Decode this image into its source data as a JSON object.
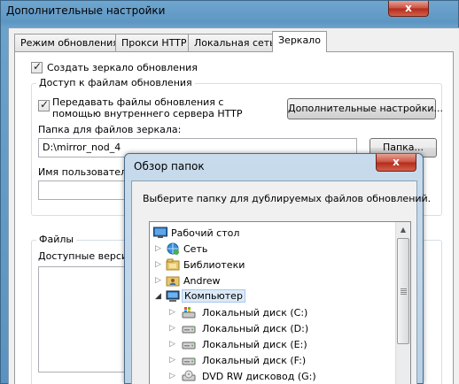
{
  "main_window": {
    "title": "Дополнительные настройки",
    "close_glyph": "x",
    "tabs": [
      {
        "label": "Режим обновления",
        "active": false
      },
      {
        "label": "Прокси HTTP",
        "active": false
      },
      {
        "label": "Локальная сеть",
        "active": false
      },
      {
        "label": "Зеркало",
        "active": true
      }
    ],
    "create_mirror": {
      "label": "Создать зеркало обновления",
      "checked": true
    },
    "access_group": {
      "title": "Доступ к файлам обновления",
      "http_server": {
        "label": "Передавать файлы обновления с помощью внутреннего сервера HTTP",
        "checked": true
      },
      "advanced_button": "Дополнительные настройки...",
      "folder_label": "Папка для файлов зеркала:",
      "folder_value": "D:\\mirror_nod_4",
      "folder_button": "Папка...",
      "username_label": "Имя пользователя:"
    },
    "files_group": {
      "title": "Файлы",
      "available_label": "Доступные версии:"
    }
  },
  "browse_dialog": {
    "title": "Обзор папок",
    "close_glyph": "x",
    "description": "Выберите папку для дублируемых файлов обновлений.",
    "tree": [
      {
        "label": "Рабочий стол",
        "icon": "desktop-icon",
        "level": 0,
        "expander": ""
      },
      {
        "label": "Сеть",
        "icon": "network-icon",
        "level": 1,
        "expander": "collapsed"
      },
      {
        "label": "Библиотеки",
        "icon": "libraries-icon",
        "level": 1,
        "expander": "collapsed"
      },
      {
        "label": "Andrew",
        "icon": "user-folder-icon",
        "level": 1,
        "expander": "collapsed"
      },
      {
        "label": "Компьютер",
        "icon": "computer-icon",
        "level": 1,
        "expander": "expanded",
        "selected": true
      },
      {
        "label": "Локальный диск (C:)",
        "icon": "system-drive-icon",
        "level": 2,
        "expander": "collapsed"
      },
      {
        "label": "Локальный диск (D:)",
        "icon": "drive-icon",
        "level": 2,
        "expander": "collapsed"
      },
      {
        "label": "Локальный диск (E:)",
        "icon": "drive-icon",
        "level": 2,
        "expander": "collapsed"
      },
      {
        "label": "Локальный диск (F:)",
        "icon": "drive-icon",
        "level": 2,
        "expander": "collapsed"
      },
      {
        "label": "DVD RW дисковод (G:)",
        "icon": "dvd-drive-icon",
        "level": 2,
        "expander": "collapsed"
      }
    ]
  }
}
